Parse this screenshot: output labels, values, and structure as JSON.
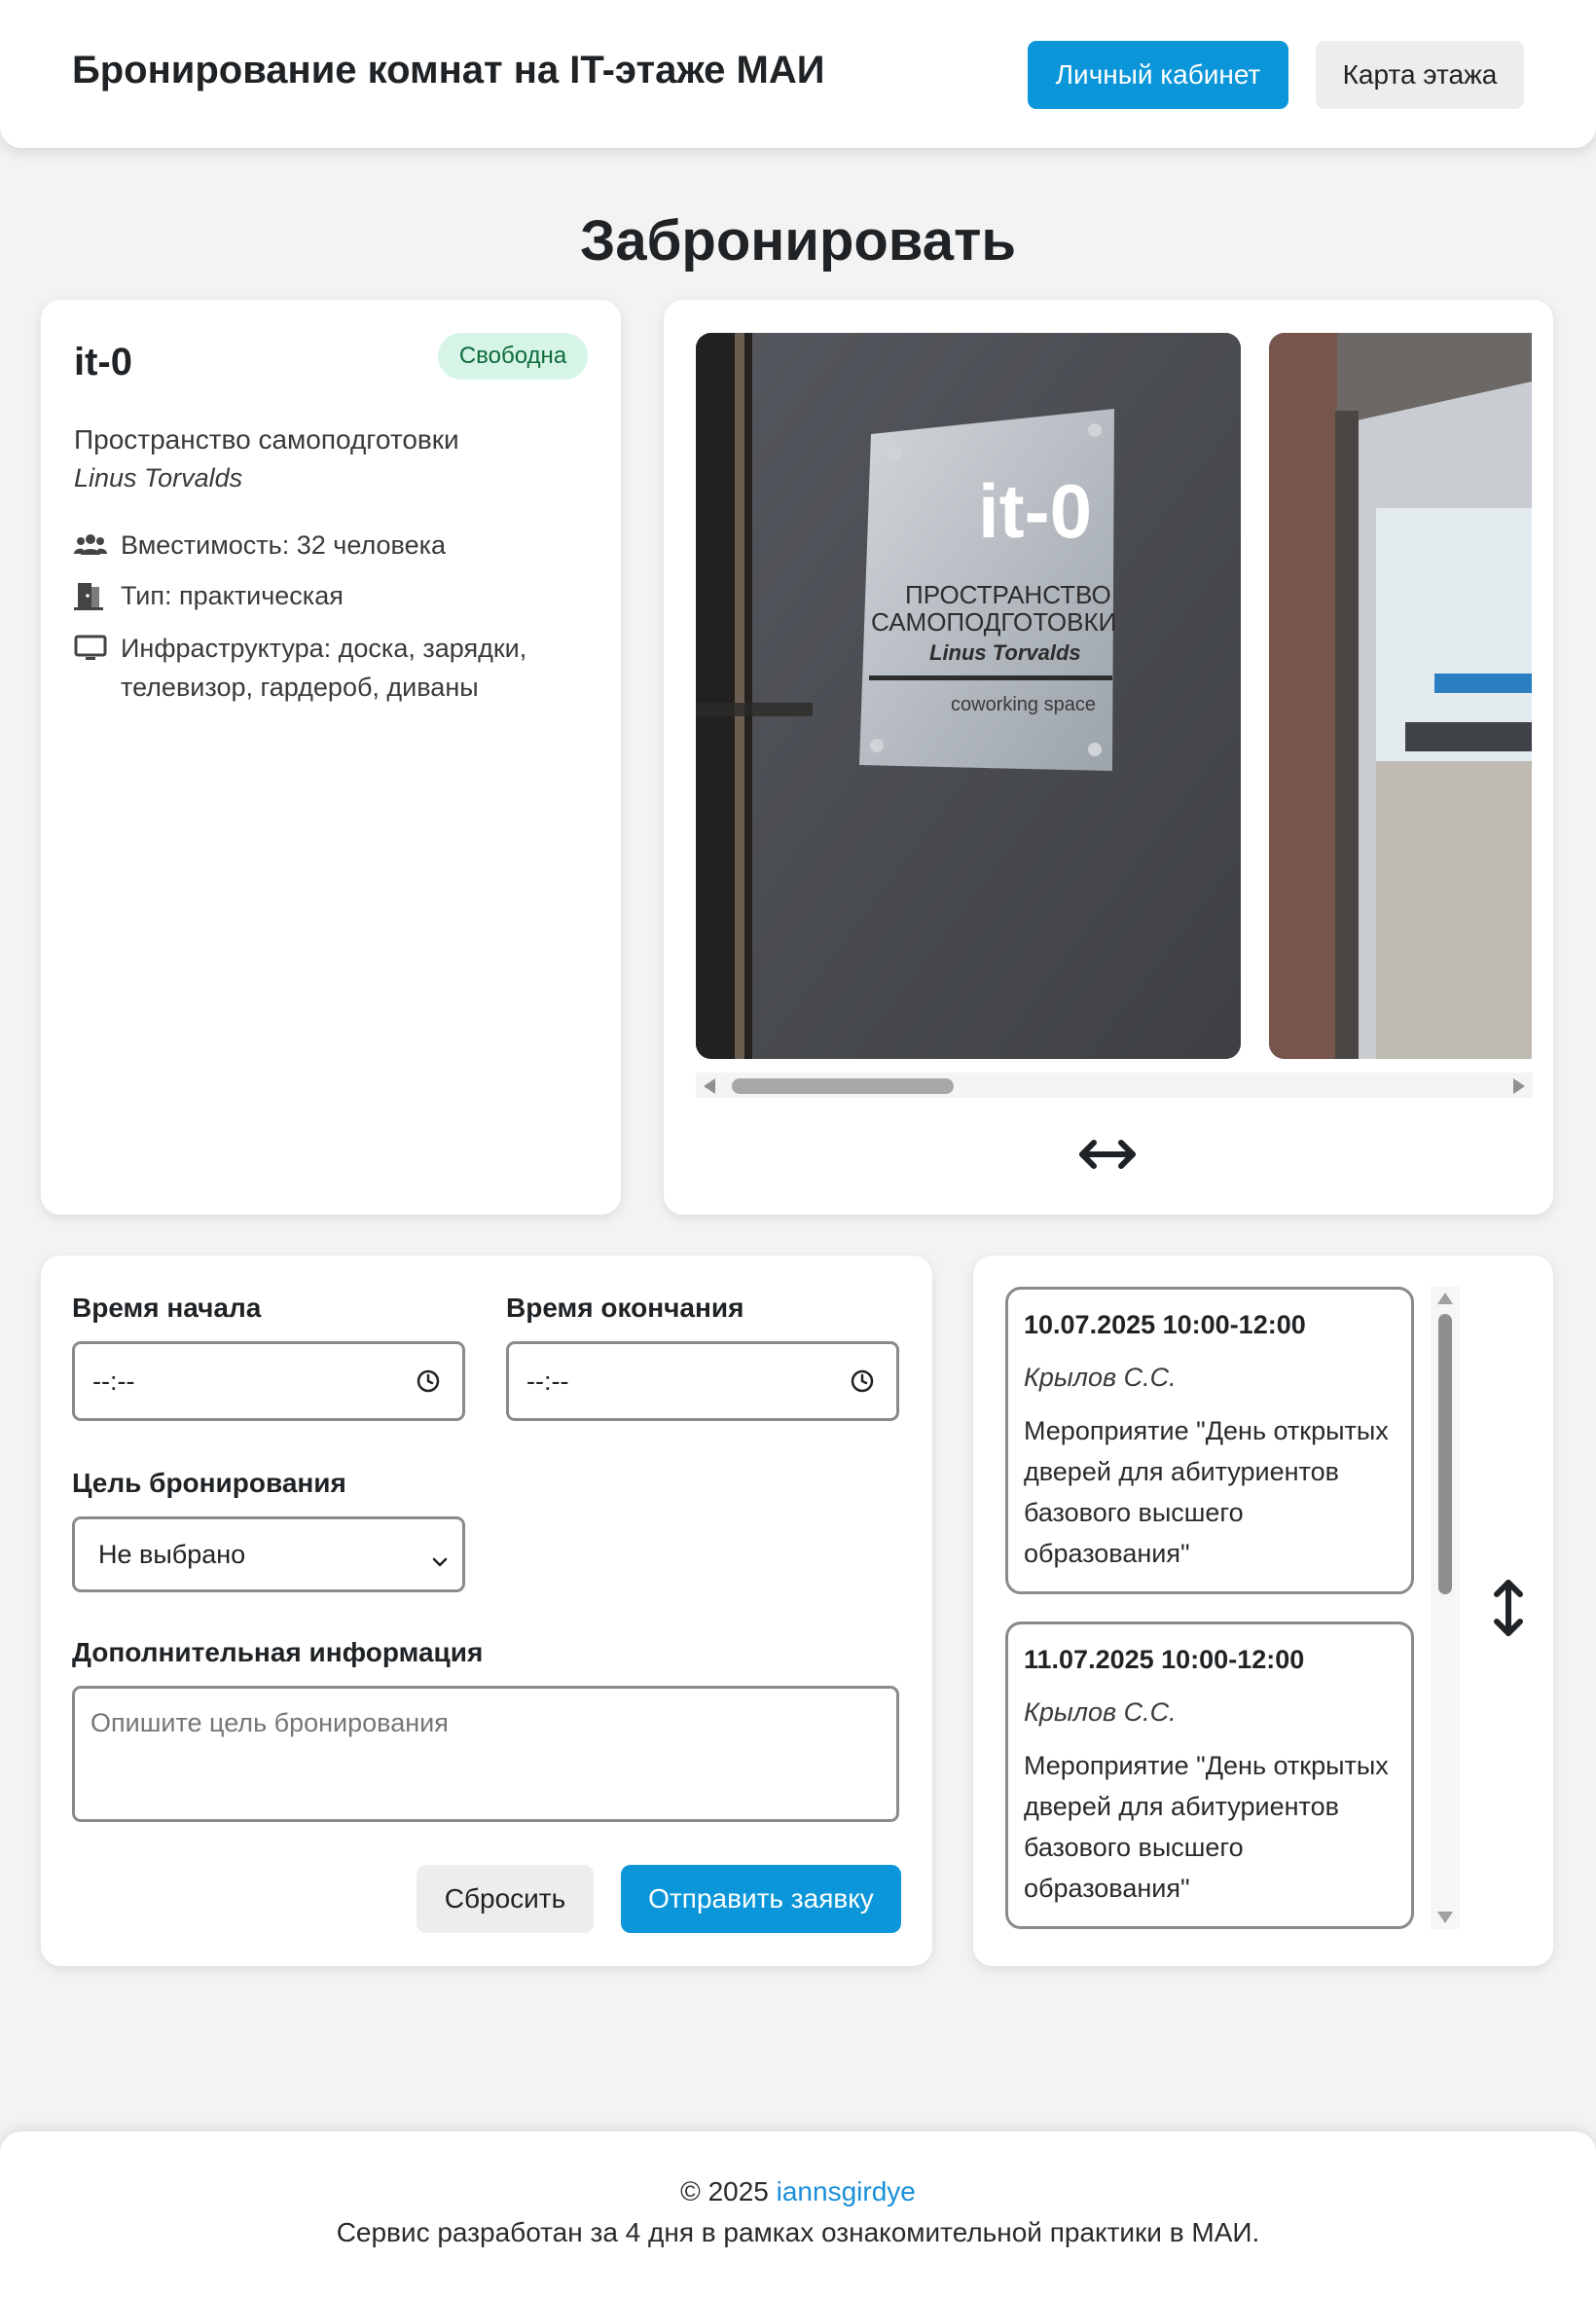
{
  "header": {
    "brand": "Бронирование комнат на IT-этаже МАИ",
    "account_label": "Личный кабинет",
    "map_label": "Карта этажа"
  },
  "page_title": "Забронировать",
  "room": {
    "name": "it-0",
    "status": "Свободна",
    "type_name": "Пространство самоподготовки",
    "person": "Linus Torvalds",
    "capacity": "Вместимость: 32 человека",
    "kind": "Тип: практическая",
    "infrastructure": "Инфраструктура: доска, зарядки, телевизор, гардероб, диваны",
    "icons": [
      "users-icon",
      "door-icon",
      "monitor-icon"
    ]
  },
  "gallery": {
    "sign_text_big": "it-0",
    "sign_line1": "ПРОСТРАНСТВО",
    "sign_line2": "САМОПОДГОТОВКИ",
    "sign_line3": "Linus Torvalds",
    "sign_line4": "coworking space",
    "scroll_hint_icon": "horizontal-arrows-icon"
  },
  "form": {
    "start_label": "Время начала",
    "start_value": "--:--",
    "end_label": "Время окончания",
    "end_value": "--:--",
    "purpose_label": "Цель бронирования",
    "purpose_selected": "Не выбрано",
    "extra_label": "Дополнительная информация",
    "extra_placeholder": "Опишите цель бронирования",
    "reset_label": "Сбросить",
    "submit_label": "Отправить заявку"
  },
  "bookings": [
    {
      "date": "10.07.2025 10:00-12:00",
      "person": "Крылов С.С.",
      "description": "Мероприятие \"День открытых дверей для абитуриентов базового высшего образования\""
    },
    {
      "date": "11.07.2025 10:00-12:00",
      "person": "Крылов С.С.",
      "description": "Мероприятие \"День открытых дверей для абитуриентов базового высшего образования\""
    }
  ],
  "footer": {
    "copyright": "© 2025",
    "author": "iannsgirdye",
    "note": "Сервис разработан за 4 дня в рамках ознакомительной практики в МАИ."
  },
  "colors": {
    "primary": "#0a96d8",
    "badge_bg": "#d6f5e6",
    "badge_text": "#0f6b3c",
    "page_bg": "#f3f3f3"
  }
}
